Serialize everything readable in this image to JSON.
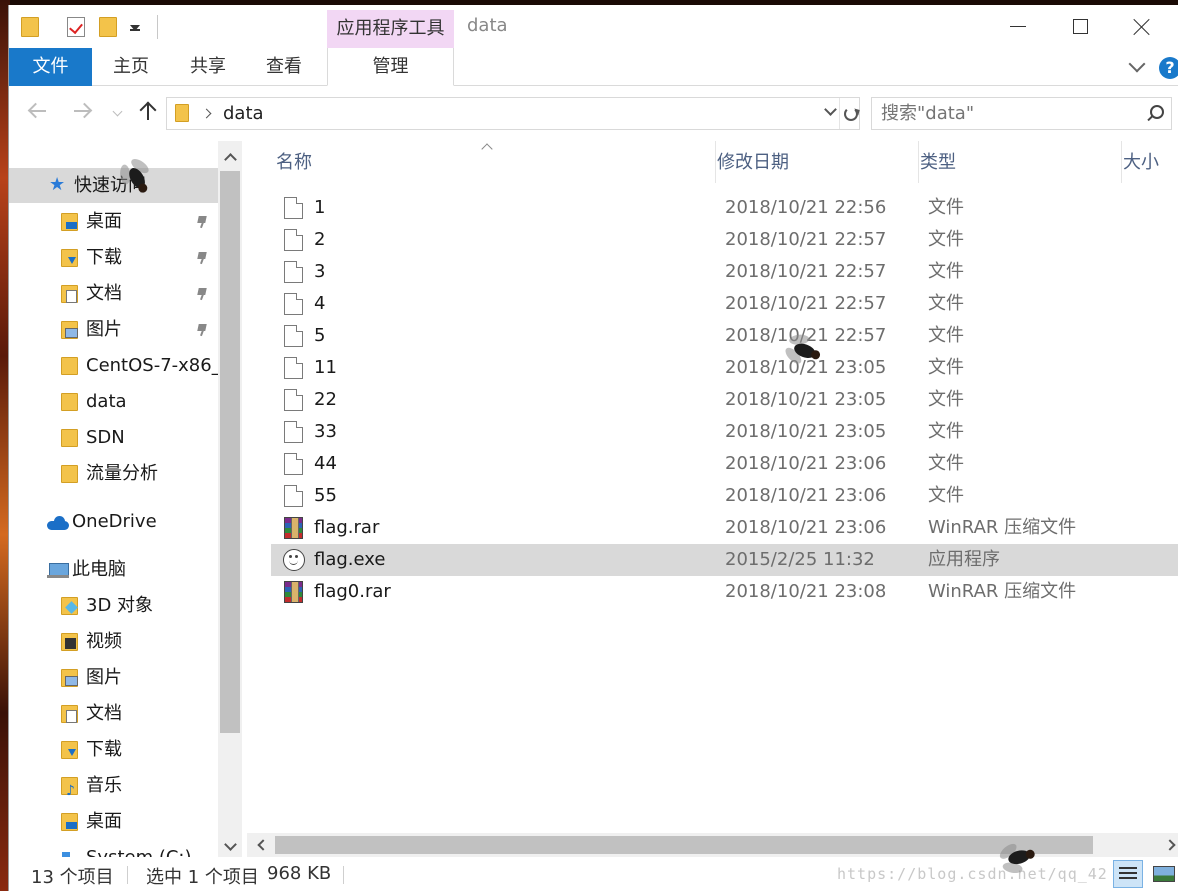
{
  "window": {
    "title": "data",
    "context_tab_group": "应用程序工具"
  },
  "ribbon": {
    "tabs": [
      "文件",
      "主页",
      "共享",
      "查看",
      "管理"
    ],
    "help_label": "?"
  },
  "address": {
    "path": "data"
  },
  "search": {
    "placeholder": "搜索\"data\""
  },
  "sidebar": {
    "items": [
      {
        "label": "快速访问",
        "icon": "star-icon",
        "pinned": false,
        "active": true
      },
      {
        "label": "桌面",
        "icon": "desktop-folder-icon",
        "pinned": true
      },
      {
        "label": "下载",
        "icon": "downloads-folder-icon",
        "pinned": true
      },
      {
        "label": "文档",
        "icon": "documents-folder-icon",
        "pinned": true
      },
      {
        "label": "图片",
        "icon": "pictures-folder-icon",
        "pinned": true
      },
      {
        "label": "CentOS-7-x86_",
        "icon": "folder-icon",
        "pinned": false
      },
      {
        "label": "data",
        "icon": "folder-icon",
        "pinned": false
      },
      {
        "label": "SDN",
        "icon": "folder-icon",
        "pinned": false
      },
      {
        "label": "流量分析",
        "icon": "folder-icon",
        "pinned": false
      },
      {
        "label": "OneDrive",
        "icon": "onedrive-cloud-icon",
        "pinned": false
      },
      {
        "label": "此电脑",
        "icon": "this-pc-icon",
        "pinned": false
      },
      {
        "label": "3D 对象",
        "icon": "3d-objects-folder-icon",
        "pinned": false
      },
      {
        "label": "视频",
        "icon": "videos-folder-icon",
        "pinned": false
      },
      {
        "label": "图片",
        "icon": "pictures-folder-icon",
        "pinned": false
      },
      {
        "label": "文档",
        "icon": "documents-folder-icon",
        "pinned": false
      },
      {
        "label": "下载",
        "icon": "downloads-folder-icon",
        "pinned": false
      },
      {
        "label": "音乐",
        "icon": "music-folder-icon",
        "pinned": false
      },
      {
        "label": "桌面",
        "icon": "desktop-folder-icon",
        "pinned": false
      },
      {
        "label": "System (C:)",
        "icon": "system-drive-icon",
        "pinned": false
      }
    ]
  },
  "columns": {
    "name": "名称",
    "date": "修改日期",
    "type": "类型",
    "size": "大小"
  },
  "files": [
    {
      "name": "1",
      "date": "2018/10/21 22:56",
      "type": "文件",
      "icon": "blank-file-icon"
    },
    {
      "name": "2",
      "date": "2018/10/21 22:57",
      "type": "文件",
      "icon": "blank-file-icon"
    },
    {
      "name": "3",
      "date": "2018/10/21 22:57",
      "type": "文件",
      "icon": "blank-file-icon"
    },
    {
      "name": "4",
      "date": "2018/10/21 22:57",
      "type": "文件",
      "icon": "blank-file-icon"
    },
    {
      "name": "5",
      "date": "2018/10/21 22:57",
      "type": "文件",
      "icon": "blank-file-icon"
    },
    {
      "name": "11",
      "date": "2018/10/21 23:05",
      "type": "文件",
      "icon": "blank-file-icon"
    },
    {
      "name": "22",
      "date": "2018/10/21 23:05",
      "type": "文件",
      "icon": "blank-file-icon"
    },
    {
      "name": "33",
      "date": "2018/10/21 23:05",
      "type": "文件",
      "icon": "blank-file-icon"
    },
    {
      "name": "44",
      "date": "2018/10/21 23:06",
      "type": "文件",
      "icon": "blank-file-icon"
    },
    {
      "name": "55",
      "date": "2018/10/21 23:06",
      "type": "文件",
      "icon": "blank-file-icon"
    },
    {
      "name": "flag.rar",
      "date": "2018/10/21 23:06",
      "type": "WinRAR 压缩文件",
      "icon": "winrar-archive-icon"
    },
    {
      "name": "flag.exe",
      "date": "2015/2/25 11:32",
      "type": "应用程序",
      "icon": "application-exe-icon",
      "selected": true
    },
    {
      "name": "flag0.rar",
      "date": "2018/10/21 23:08",
      "type": "WinRAR 压缩文件",
      "icon": "winrar-archive-icon"
    }
  ],
  "status": {
    "item_count": "13 个项目",
    "selection": "选中 1 个项目",
    "selection_size": "968 KB",
    "watermark": "https://blog.csdn.net/qq_42"
  },
  "colors": {
    "accent": "#1979ca",
    "context_tab": "#f2d7f4",
    "selection": "#d9d9d9",
    "header_text": "#4d6082"
  }
}
